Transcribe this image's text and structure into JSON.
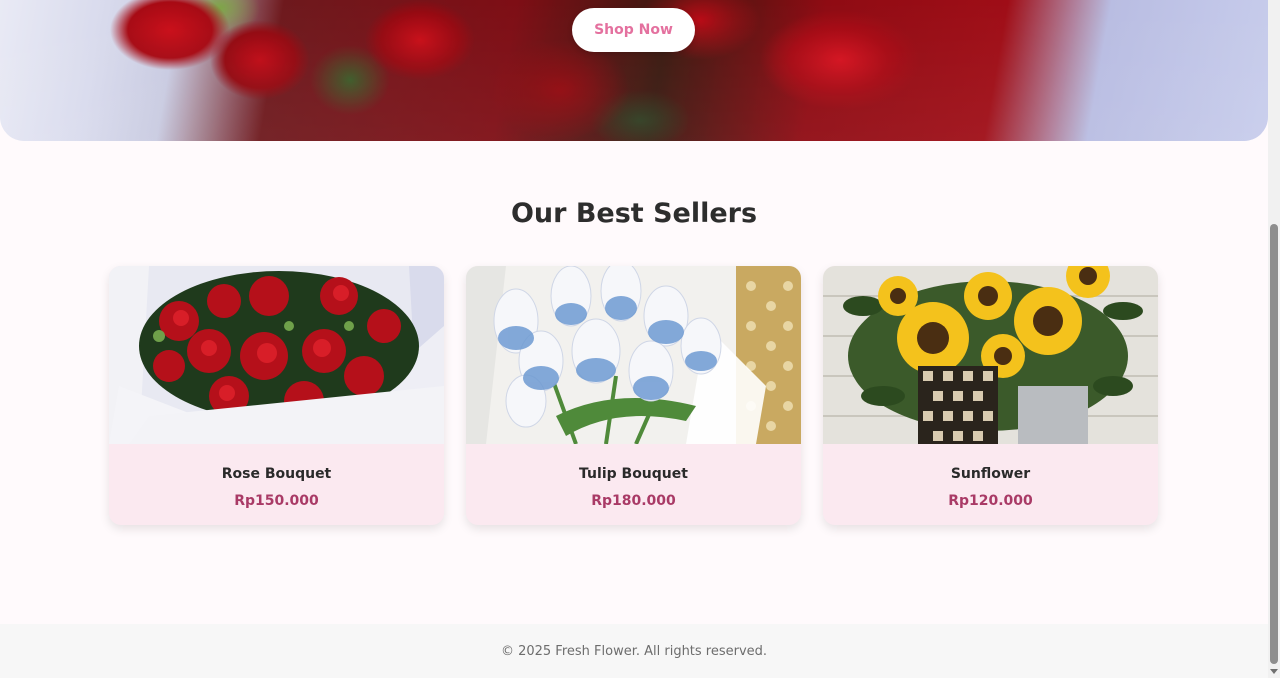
{
  "hero": {
    "cta_label": "Shop Now"
  },
  "best_sellers": {
    "title": "Our Best Sellers",
    "products": [
      {
        "name": "Rose Bouquet",
        "price": "Rp150.000",
        "image": "red-rose-bouquet-photo"
      },
      {
        "name": "Tulip Bouquet",
        "price": "Rp180.000",
        "image": "blue-tulip-bouquet-photo"
      },
      {
        "name": "Sunflower",
        "price": "Rp120.000",
        "image": "sunflower-bucket-photo"
      }
    ]
  },
  "footer": {
    "copyright": "© 2025 Fresh Flower. All rights reserved."
  },
  "colors": {
    "accent_pink": "#e0729e",
    "price": "#a93a66",
    "card_bg": "#fbe9f0",
    "footer_bg": "#f7f7f7"
  }
}
